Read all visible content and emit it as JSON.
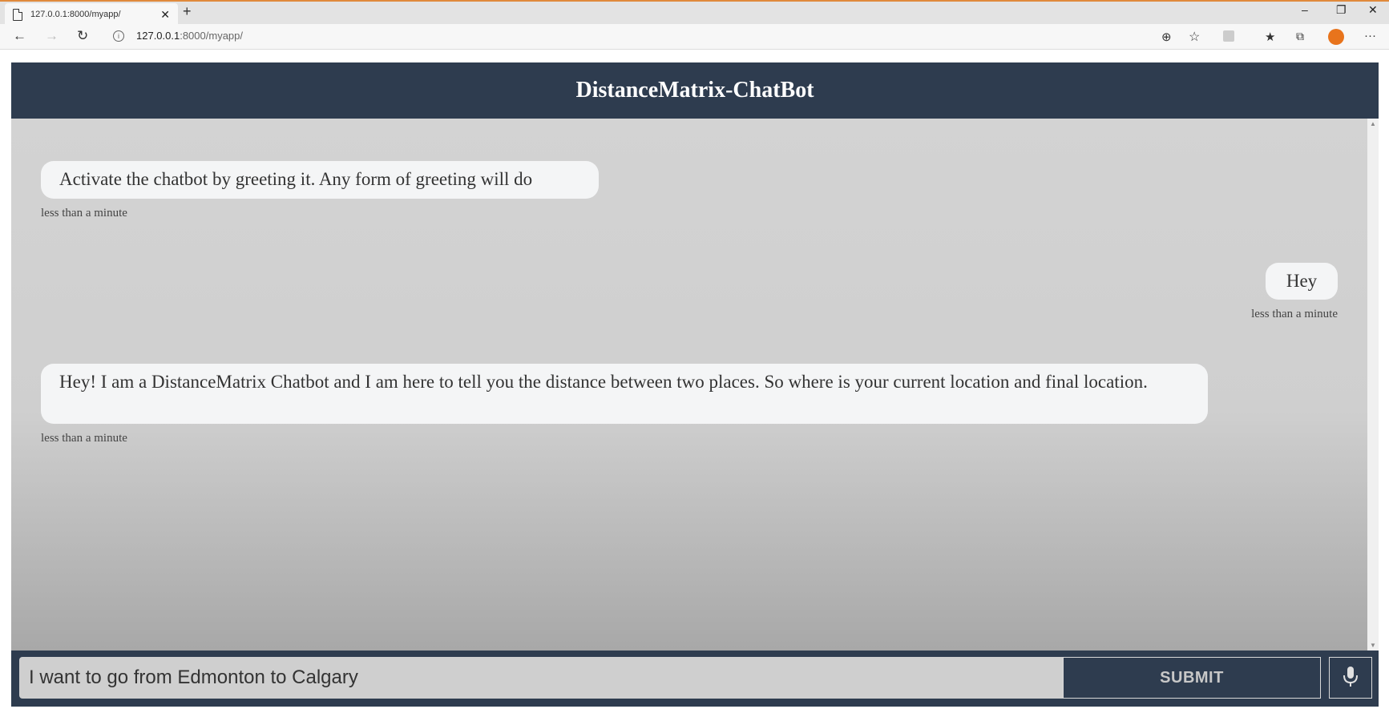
{
  "browser": {
    "tab_title": "127.0.0.1:8000/myapp/",
    "tab_close": "✕",
    "new_tab": "+",
    "url_host": "127.0.0.1",
    "url_path": ":8000/myapp/",
    "window_controls": {
      "minimize": "–",
      "restore": "❐",
      "close": "✕"
    }
  },
  "app": {
    "title": "DistanceMatrix-ChatBot"
  },
  "messages": [
    {
      "sender": "bot",
      "text": "Activate the chatbot by greeting it. Any form of greeting will do",
      "time": "less than a minute"
    },
    {
      "sender": "user",
      "text": "Hey",
      "time": "less than a minute"
    },
    {
      "sender": "bot",
      "text": "Hey! I am a DistanceMatrix Chatbot and I am here to tell you the distance between two places. So where is your current location and final location.",
      "time": "less than a minute"
    }
  ],
  "input": {
    "value": "I want to go from Edmonton to Calgary",
    "submit_label": "SUBMIT"
  },
  "icons": {
    "back": "back-arrow-icon",
    "forward": "forward-arrow-icon",
    "refresh": "refresh-icon",
    "zoom": "zoom-icon",
    "star": "favorite-star-icon",
    "mic": "microphone-icon"
  },
  "colors": {
    "header": "#2e3c4f",
    "bubble": "#f4f5f6",
    "accent_avatar": "#e8741c"
  }
}
